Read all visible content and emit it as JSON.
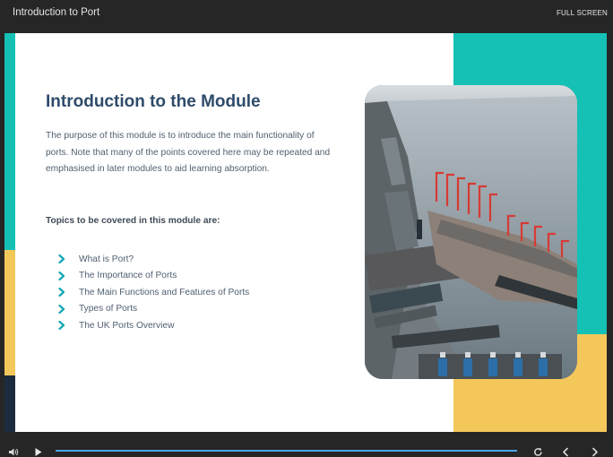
{
  "app": {
    "title": "Introduction to Port",
    "fullscreen_label": "FULL SCREEN"
  },
  "slide": {
    "heading": "Introduction to the Module",
    "intro": "The purpose of this module is to introduce the main functionality of ports. Note that many of the points covered here may be repeated and emphasised in later modules to aid learning absorption.",
    "topics_heading": "Topics to be covered in this module are:",
    "topics": [
      "What is Port?",
      "The Importance of Ports",
      "The Main Functions and Features of Ports",
      "Types of Ports",
      "The UK Ports Overview"
    ]
  },
  "player": {
    "progress": 1.0
  },
  "colors": {
    "teal": "#14c1b4",
    "yellow": "#f4c75b",
    "navy": "#1d2b3f",
    "heading": "#2e4b6b",
    "chevron": "#13a6b4",
    "progress": "#4aa7e8"
  },
  "icons": {
    "topic_bullet": "chevron-right-icon",
    "volume": "volume-icon",
    "play": "play-icon",
    "replay": "replay-icon",
    "previous": "chevron-left-icon",
    "next": "chevron-right-icon"
  }
}
